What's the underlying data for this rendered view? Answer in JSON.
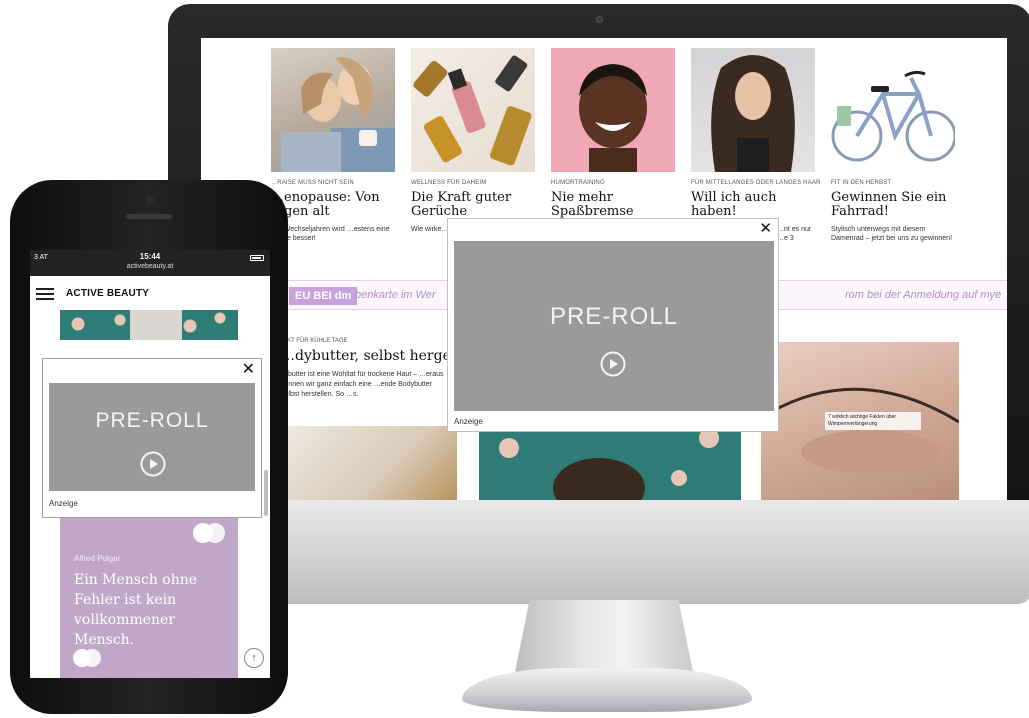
{
  "desktop": {
    "articles": [
      {
        "kicker": "…RAISE MUSS NICHT SEIN",
        "title": "…enopause: Von …gen alt",
        "teaser": "…n Wechseljahren wird …estens eine Sache besser!"
      },
      {
        "kicker": "WELLNESS FÜR DAHEIM",
        "title": "Die Kraft guter Gerüche",
        "teaser": "Wie wirke… wie wend…"
      },
      {
        "kicker": "HUMORTRAINING",
        "title": "Nie mehr Spaßbremse",
        "teaser": ""
      },
      {
        "kicker": "FÜR MITTELLANGES ODER LANGES HAAR",
        "title": "Will ich auch haben!",
        "teaser": "…nt es nur …e 3"
      },
      {
        "kicker": "FIT IN DEN HERBST",
        "title": "Gewinnen Sie ein Fahrrad!",
        "teaser": "Stylisch unterwegs mit diesem Damenrad – jetzt bei uns zu gewinnen!"
      }
    ],
    "ribbon": {
      "badge": "EU BEI dm",
      "text_left": "benkarte im Wer",
      "text_right": "rom bei der Anmeldung auf mye"
    },
    "lower_article": {
      "kicker": "…KT FÜR KÜHLE TAGE",
      "title": "…dybutter, selbst hergestellt",
      "teaser": "…butter ist eine Wohltat für trockene Haut – …eraus können wir ganz einfach eine …ende Bodybutter selbst herstellen. So …s."
    },
    "image_caption": "7 wirklich wichtige Fakten über Wimpernverlängerung",
    "preroll": {
      "label": "PRE-ROLL",
      "ad_label": "Anzeige",
      "close": "✕"
    }
  },
  "mobile": {
    "status": {
      "carrier": "3 AT",
      "time": "15:44",
      "url": "activebeauty.at"
    },
    "brand": "ACTIVE BEAUTY",
    "preroll": {
      "label": "PRE-ROLL",
      "ad_label": "Anzeige",
      "close": "✕"
    },
    "quote": {
      "author": "Alfred Polgar",
      "text": "Ein Mensch ohne Fehler ist kein vollkommener Mensch."
    },
    "scroll_top": "↑"
  },
  "colors": {
    "accent_purple": "#c8a2dc",
    "quote_bg": "#c0a7c8",
    "video_placeholder": "#9a9a9a",
    "teal": "#2e7c76"
  }
}
